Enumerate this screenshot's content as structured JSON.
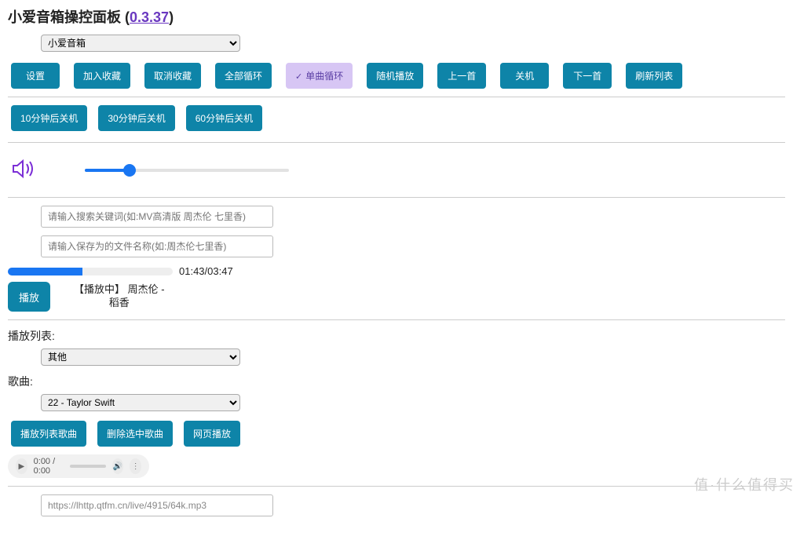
{
  "header": {
    "title_prefix": "小爱音箱操控面板",
    "version_link": "0.3.37"
  },
  "device_select": {
    "selected": "小爱音箱"
  },
  "main_buttons": {
    "settings": "设置",
    "add_fav": "加入收藏",
    "cancel_fav": "取消收藏",
    "loop_all": "全部循环",
    "loop_one": "单曲循环",
    "shuffle": "随机播放",
    "prev": "上一首",
    "power": "关机",
    "next": "下一首",
    "refresh_list": "刷新列表"
  },
  "timer_buttons": {
    "t10": "10分钟后关机",
    "t30": "30分钟后关机",
    "t60": "60分钟后关机"
  },
  "volume": {
    "percent": 22
  },
  "search": {
    "keyword_placeholder": "请输入搜索关键词(如:MV高清版 周杰伦 七里香)",
    "save_name_placeholder": "请输入保存为的文件名称(如:周杰伦七里香)"
  },
  "progress": {
    "elapsed": "01:43",
    "total": "03:47",
    "percent": 45
  },
  "playback": {
    "play_label": "播放",
    "now_playing_line1": "【播放中】 周杰伦 -",
    "now_playing_line2": "稻香"
  },
  "playlist": {
    "label": "播放列表:",
    "selected": "其他"
  },
  "song": {
    "label": "歌曲:",
    "selected": "22 - Taylor Swift"
  },
  "list_buttons": {
    "play_list_song": "播放列表歌曲",
    "delete_selected": "删除选中歌曲",
    "web_play": "网页播放"
  },
  "audio": {
    "time": "0:00 / 0:00"
  },
  "url_input": {
    "value": "https://lhttp.qtfm.cn/live/4915/64k.mp3"
  },
  "watermark": "值·什么值得买"
}
